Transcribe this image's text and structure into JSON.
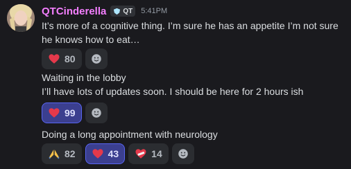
{
  "author": {
    "username": "QTCinderella",
    "tag": "QT",
    "timestamp": "5:41PM"
  },
  "messages": [
    {
      "text": "It’s more of a cognitive thing. I’m sure he has an appetite I’m not sure he knows how to eat…",
      "reactions": [
        {
          "icon": "heart-icon",
          "count": "80",
          "self": false
        }
      ]
    },
    {
      "text": "Waiting in the lobby",
      "reactions": []
    },
    {
      "text": "I’ll have lots of updates soon. I should be here for 2 hours ish",
      "reactions": [
        {
          "icon": "heart-icon",
          "count": "99",
          "self": true
        }
      ]
    },
    {
      "text": "Doing a long appointment with neurology",
      "reactions": [
        {
          "icon": "folded-hands-icon",
          "count": "82",
          "self": false
        },
        {
          "icon": "heart-icon",
          "count": "43",
          "self": true
        },
        {
          "icon": "mending-heart-icon",
          "count": "14",
          "self": false
        }
      ]
    }
  ],
  "colors": {
    "background": "#1a1a1e",
    "username": "#f47fff",
    "heart": "#e5394b",
    "selected_reaction": "#3b3f8f"
  }
}
